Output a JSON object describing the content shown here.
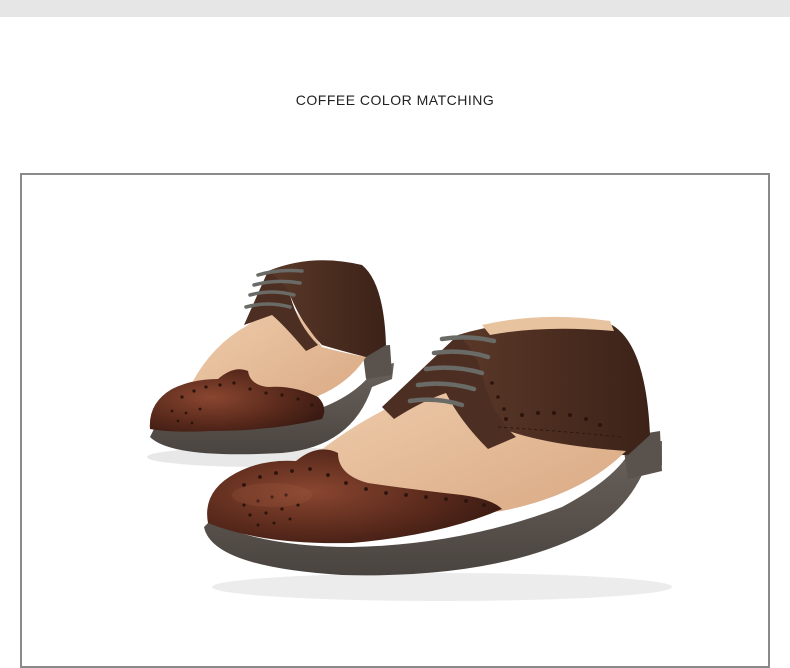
{
  "header": {
    "title": "COFFEE COLOR MATCHING"
  },
  "colors": {
    "top_bar": "#e6e6e6",
    "frame_border": "#8a8a8a",
    "dark_brown": "#4a2c20",
    "coffee_toe": "#5a2a1c",
    "tan": "#e2b896",
    "sole": "#5e5650",
    "laces": "#6a6a66"
  },
  "image": {
    "subject": "two-tone coffee brogue shoes",
    "icon": "product-photo"
  }
}
